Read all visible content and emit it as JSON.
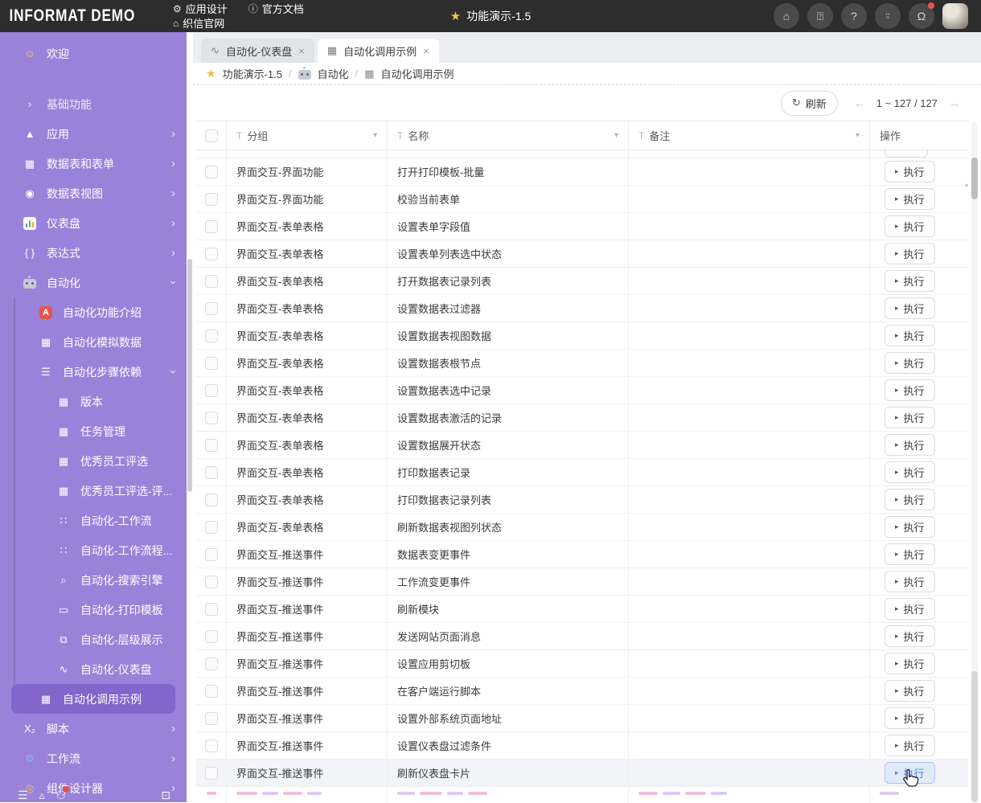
{
  "topbar": {
    "logo": "INFORMAT DEMO",
    "menu": [
      {
        "icon": "gear-icon",
        "glyph": "⚙",
        "label": "应用设计"
      },
      {
        "icon": "info-icon",
        "glyph": "ⓘ",
        "label": "官方文档"
      },
      {
        "icon": "home-icon",
        "glyph": "⌂",
        "label": "织信官网"
      }
    ],
    "title": {
      "star_glyph": "★",
      "text": "功能演示-1.5"
    },
    "actions": [
      {
        "icon": "home-icon",
        "glyph": "⌂",
        "badge": false
      },
      {
        "icon": "feedback-icon",
        "glyph": "⍰",
        "badge": false
      },
      {
        "icon": "help-icon",
        "glyph": "?",
        "badge": false
      },
      {
        "icon": "bot-icon",
        "glyph": "⍤",
        "badge": false
      },
      {
        "icon": "bell-icon",
        "glyph": "Ω",
        "badge": true
      }
    ],
    "badge_color": "#e8504a"
  },
  "sidebar": {
    "bg_color": "#9a82da",
    "selected_color": "#8465cb",
    "items": [
      {
        "label": "欢迎",
        "level": 0,
        "icon": "smiley-icon",
        "glyph": "☺",
        "glyph_color": "#f7c948",
        "gap_after": true
      },
      {
        "label": "基础功能",
        "level": 0,
        "icon": "chevron-right-icon",
        "glyph": "›",
        "dim": true
      },
      {
        "label": "应用",
        "level": 0,
        "icon": "app-icon",
        "glyph": "▲",
        "chevron": "right"
      },
      {
        "label": "数据表和表单",
        "level": 0,
        "icon": "table-icon",
        "glyph": "▦",
        "chevron": "right"
      },
      {
        "label": "数据表视图",
        "level": 0,
        "icon": "table-view-icon",
        "glyph": "◉",
        "chevron": "right"
      },
      {
        "label": "仪表盘",
        "level": 0,
        "icon": "bar-chart-icon",
        "special": "bars",
        "chevron": "right"
      },
      {
        "label": "表达式",
        "level": 0,
        "icon": "braces-icon",
        "glyph": "{ }",
        "chevron": "right"
      },
      {
        "label": "自动化",
        "level": 0,
        "icon": "robot-icon",
        "special": "robot",
        "chevron": "down"
      },
      {
        "label": "自动化功能介绍",
        "level": 1,
        "icon": "a-badge-icon",
        "special": "a-badge",
        "guide": true
      },
      {
        "label": "自动化模拟数据",
        "level": 1,
        "icon": "table-icon",
        "glyph": "▦",
        "guide": true
      },
      {
        "label": "自动化步骤依赖",
        "level": 1,
        "icon": "database-icon",
        "glyph": "☰",
        "chevron": "down",
        "guide": true
      },
      {
        "label": "版本",
        "level": 2,
        "icon": "table-icon",
        "glyph": "▦",
        "guide": true
      },
      {
        "label": "任务管理",
        "level": 2,
        "icon": "table-icon",
        "glyph": "▦",
        "guide": true
      },
      {
        "label": "优秀员工评选",
        "level": 2,
        "icon": "table-icon",
        "glyph": "▦",
        "guide": true
      },
      {
        "label": "优秀员工评选-评...",
        "level": 2,
        "icon": "table-icon",
        "glyph": "▦",
        "guide": true
      },
      {
        "label": "自动化-工作流",
        "level": 2,
        "icon": "workflow-icon",
        "glyph": "∷",
        "guide": true
      },
      {
        "label": "自动化-工作流程...",
        "level": 2,
        "icon": "workflow-icon",
        "glyph": "∷",
        "guide": true
      },
      {
        "label": "自动化-搜索引擎",
        "level": 2,
        "icon": "search-icon",
        "glyph": "⌕",
        "guide": true
      },
      {
        "label": "自动化-打印模板",
        "level": 2,
        "icon": "print-template-icon",
        "glyph": "▭",
        "guide": true
      },
      {
        "label": "自动化-层级展示",
        "level": 2,
        "icon": "layers-icon",
        "glyph": "⧉",
        "guide": true
      },
      {
        "label": "自动化-仪表盘",
        "level": 2,
        "icon": "line-chart-icon",
        "glyph": "∿",
        "guide": true
      },
      {
        "label": "自动化调用示例",
        "level": 1,
        "icon": "table-icon",
        "glyph": "▦",
        "selected": true
      },
      {
        "label": "脚本",
        "level": 0,
        "icon": "script-icon",
        "glyph": "X₂",
        "chevron": "right"
      },
      {
        "label": "工作流",
        "level": 0,
        "icon": "workflow-blue-icon",
        "glyph": "⚙",
        "glyph_color": "#7fb4f0",
        "chevron": "right"
      },
      {
        "label": "组件设计器",
        "level": 0,
        "icon": "compass-icon",
        "glyph": "◎",
        "glyph_color": "#f0c36c",
        "chevron": "right"
      }
    ],
    "footer_icons": [
      {
        "icon": "menu-lines-icon",
        "glyph": "☰",
        "badge": false
      },
      {
        "icon": "font-icon",
        "glyph": "▵",
        "badge": false
      },
      {
        "icon": "profile-icon",
        "glyph": "⚇",
        "badge": true
      }
    ],
    "footer_right_icon": {
      "icon": "collapse-panel-icon",
      "glyph": "⊡"
    }
  },
  "tabs": [
    {
      "label": "自动化-仪表盘",
      "icon": "line-chart-icon",
      "glyph": "∿",
      "close_glyph": "×",
      "active": false
    },
    {
      "label": "自动化调用示例",
      "icon": "table-icon",
      "glyph": "▦",
      "close_glyph": "×",
      "active": true
    }
  ],
  "breadcrumb": {
    "star_glyph": "★",
    "items": [
      {
        "label": "功能演示-1.5",
        "icon": "star-icon"
      },
      {
        "label": "自动化",
        "icon": "robot-icon"
      },
      {
        "label": "自动化调用示例",
        "icon": "table-icon",
        "glyph": "▦"
      }
    ],
    "separator": "/"
  },
  "toolbar": {
    "refresh_label": "刷新",
    "refresh_glyph": "↻",
    "pagination": {
      "prev_glyph": "←",
      "text": "1 ~ 127 / 127",
      "next_glyph": "→"
    }
  },
  "table": {
    "columns": [
      {
        "label": "分组",
        "filter_glyph": "T",
        "caret_glyph": "▾"
      },
      {
        "label": "名称",
        "filter_glyph": "T",
        "caret_glyph": "▾"
      },
      {
        "label": "备注",
        "filter_glyph": "T",
        "caret_glyph": "▾"
      },
      {
        "label": "操作"
      }
    ],
    "action_label": "执行",
    "action_play_glyph": "▸",
    "rows": [
      {
        "group": "界面交互-界面功能",
        "name": "打开打印模板-批量",
        "note": ""
      },
      {
        "group": "界面交互-界面功能",
        "name": "校验当前表单",
        "note": ""
      },
      {
        "group": "界面交互-表单表格",
        "name": "设置表单字段值",
        "note": ""
      },
      {
        "group": "界面交互-表单表格",
        "name": "设置表单列表选中状态",
        "note": ""
      },
      {
        "group": "界面交互-表单表格",
        "name": "打开数据表记录列表",
        "note": ""
      },
      {
        "group": "界面交互-表单表格",
        "name": "设置数据表过滤器",
        "note": ""
      },
      {
        "group": "界面交互-表单表格",
        "name": "设置数据表视图数据",
        "note": ""
      },
      {
        "group": "界面交互-表单表格",
        "name": "设置数据表根节点",
        "note": ""
      },
      {
        "group": "界面交互-表单表格",
        "name": "设置数据表选中记录",
        "note": ""
      },
      {
        "group": "界面交互-表单表格",
        "name": "设置数据表激活的记录",
        "note": ""
      },
      {
        "group": "界面交互-表单表格",
        "name": "设置数据展开状态",
        "note": ""
      },
      {
        "group": "界面交互-表单表格",
        "name": "打印数据表记录",
        "note": ""
      },
      {
        "group": "界面交互-表单表格",
        "name": "打印数据表记录列表",
        "note": ""
      },
      {
        "group": "界面交互-表单表格",
        "name": "刷新数据表视图列状态",
        "note": ""
      },
      {
        "group": "界面交互-推送事件",
        "name": "数据表变更事件",
        "note": ""
      },
      {
        "group": "界面交互-推送事件",
        "name": "工作流变更事件",
        "note": ""
      },
      {
        "group": "界面交互-推送事件",
        "name": "刷新模块",
        "note": ""
      },
      {
        "group": "界面交互-推送事件",
        "name": "发送网站页面消息",
        "note": ""
      },
      {
        "group": "界面交互-推送事件",
        "name": "设置应用剪切板",
        "note": ""
      },
      {
        "group": "界面交互-推送事件",
        "name": "在客户端运行脚本",
        "note": ""
      },
      {
        "group": "界面交互-推送事件",
        "name": "设置外部系统页面地址",
        "note": ""
      },
      {
        "group": "界面交互-推送事件",
        "name": "设置仪表盘过滤条件",
        "note": ""
      },
      {
        "group": "界面交互-推送事件",
        "name": "刷新仪表盘卡片",
        "note": "",
        "hovered": true
      }
    ]
  },
  "colors": {
    "topbar_bg": "#2d2d2d",
    "sidebar_bg": "#9a82da",
    "sidebar_selected": "#8465cb",
    "accent_blue": "#4d82ec",
    "star_yellow": "#f5b941",
    "badge_red": "#e8504a",
    "skeleton_pink": "#f0bede",
    "skeleton_violet": "#ddc9f0"
  }
}
